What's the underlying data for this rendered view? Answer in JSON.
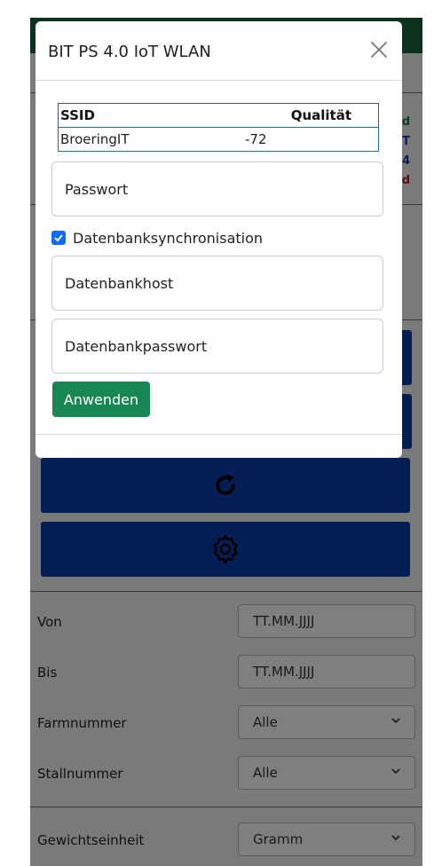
{
  "modal": {
    "title": "BIT PS 4.0 IoT WLAN",
    "table": {
      "headers": [
        "SSID",
        "Qualität"
      ],
      "rows": [
        {
          "ssid": "BroeringIT",
          "quality": "-72"
        }
      ]
    },
    "password_placeholder": "Passwort",
    "db_sync": {
      "label": "Datenbanksynchronisation",
      "checked": true
    },
    "db_host_placeholder": "Datenbankhost",
    "db_password_placeholder": "Datenbankpasswort",
    "apply_label": "Anwenden"
  },
  "status_partial": [
    {
      "text": "d",
      "color": "#1a7f3c"
    },
    {
      "text": "T",
      "color": "#1a3f9f"
    },
    {
      "text": "4",
      "color": "#1a3f9f"
    },
    {
      "text": "d",
      "color": "#c22020"
    }
  ],
  "buttons": [
    {
      "icon": "refresh-icon"
    },
    {
      "icon": "gear-icon"
    }
  ],
  "filters": {
    "von": {
      "label": "Von",
      "placeholder": "TT.MM.JJJJ"
    },
    "bis": {
      "label": "Bis",
      "placeholder": "TT.MM.JJJJ"
    },
    "farm": {
      "label": "Farmnummer",
      "value": "Alle"
    },
    "stall": {
      "label": "Stallnummer",
      "value": "Alle"
    },
    "unit": {
      "label": "Gewichtseinheit",
      "value": "Gramm"
    }
  },
  "colors": {
    "primary": "#0b3ea8",
    "header_green": "#19673a",
    "success": "#198754",
    "checkbox": "#0d6efd"
  }
}
